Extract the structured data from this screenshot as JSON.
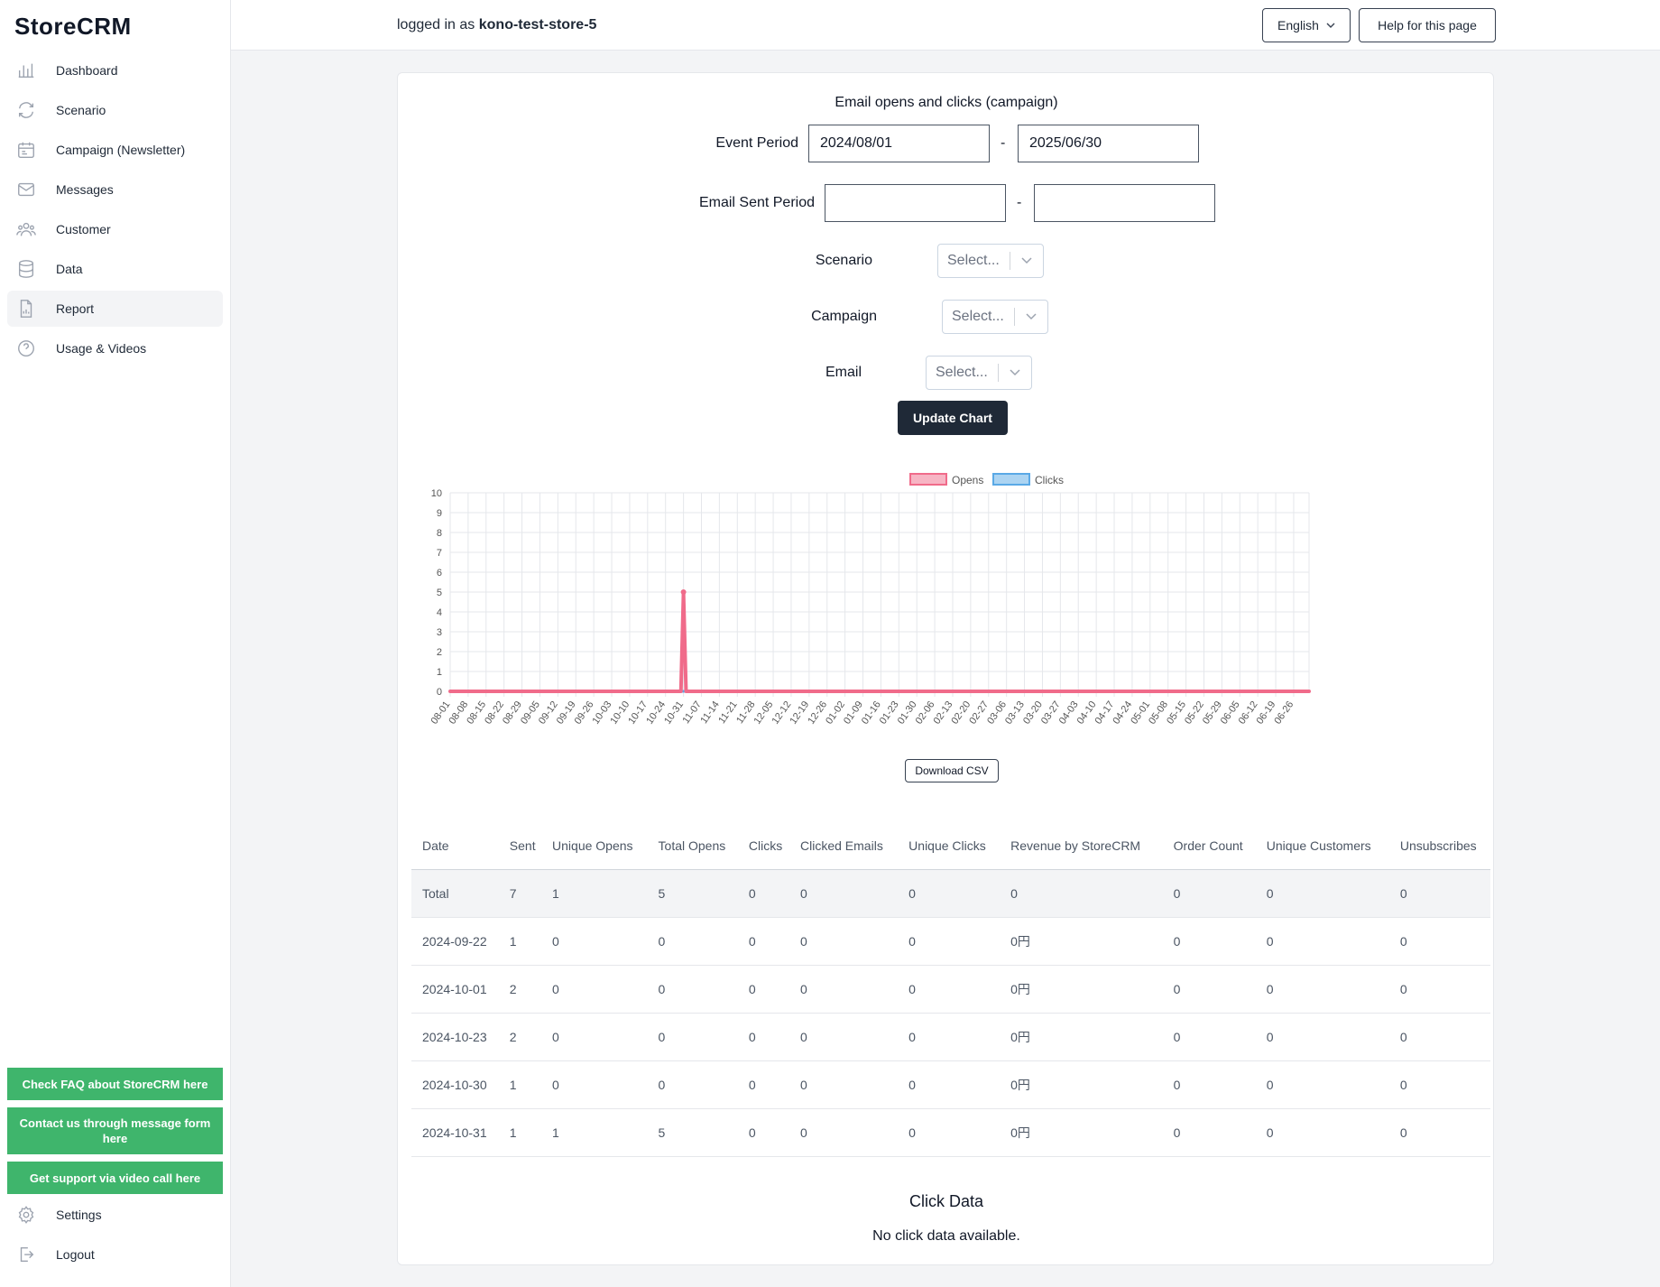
{
  "app": {
    "logo": "StoreCRM"
  },
  "sidebar": {
    "items": [
      {
        "label": "Dashboard",
        "icon": "chart-bars-icon",
        "active": false
      },
      {
        "label": "Scenario",
        "icon": "refresh-icon",
        "active": false
      },
      {
        "label": "Campaign (Newsletter)",
        "icon": "calendar-icon",
        "active": false
      },
      {
        "label": "Messages",
        "icon": "envelope-icon",
        "active": false
      },
      {
        "label": "Customer",
        "icon": "users-icon",
        "active": false
      },
      {
        "label": "Data",
        "icon": "database-icon",
        "active": false
      },
      {
        "label": "Report",
        "icon": "document-chart-icon",
        "active": true
      },
      {
        "label": "Usage & Videos",
        "icon": "question-icon",
        "active": false
      }
    ],
    "help_buttons": [
      "Check FAQ about StoreCRM here",
      "Contact us through message form here",
      "Get support via video call here"
    ],
    "settings_label": "Settings",
    "logout_label": "Logout"
  },
  "header": {
    "logged_in_prefix": "logged in as",
    "store_name": "kono-test-store-5",
    "language_label": "English",
    "help_label": "Help for this page"
  },
  "filters": {
    "title": "Email opens and clicks (campaign)",
    "event_period_label": "Event Period",
    "event_start": "2024/08/01",
    "event_end": "2025/06/30",
    "sent_period_label": "Email Sent Period",
    "sent_start": "",
    "sent_end": "",
    "dash": "-",
    "scenario_label": "Scenario",
    "campaign_label": "Campaign",
    "email_label": "Email",
    "select_placeholder": "Select...",
    "update_label": "Update Chart"
  },
  "chart_data": {
    "type": "line",
    "x": [
      "08-01",
      "08-08",
      "08-15",
      "08-22",
      "08-29",
      "09-05",
      "09-12",
      "09-19",
      "09-26",
      "10-03",
      "10-10",
      "10-17",
      "10-24",
      "10-31",
      "11-07",
      "11-14",
      "11-21",
      "11-28",
      "12-05",
      "12-12",
      "12-19",
      "12-26",
      "01-02",
      "01-09",
      "01-16",
      "01-23",
      "01-30",
      "02-06",
      "02-13",
      "02-20",
      "02-27",
      "03-06",
      "03-13",
      "03-20",
      "03-27",
      "04-03",
      "04-10",
      "04-17",
      "04-24",
      "05-01",
      "05-08",
      "05-15",
      "05-22",
      "05-29",
      "06-05",
      "06-12",
      "06-19",
      "06-26"
    ],
    "series": [
      {
        "name": "Opens",
        "color": "#f06b8a",
        "points": [
          [
            "10-31",
            5
          ]
        ],
        "baseline": 0
      },
      {
        "name": "Clicks",
        "color": "#5aa9e6",
        "points": [],
        "baseline": 0
      }
    ],
    "ylim": [
      0,
      10
    ],
    "yticks": [
      0,
      1,
      2,
      3,
      4,
      5,
      6,
      7,
      8,
      9,
      10
    ],
    "grid": true,
    "legend": "top-center"
  },
  "csv_label": "Download CSV",
  "table": {
    "headers": [
      "Date",
      "Sent",
      "Unique Opens",
      "Total Opens",
      "Clicks",
      "Clicked Emails",
      "Unique Clicks",
      "Revenue by StoreCRM",
      "Order Count",
      "Unique Customers",
      "Unsubscribes"
    ],
    "rows": [
      [
        "Total",
        "7",
        "1",
        "5",
        "0",
        "0",
        "0",
        "0",
        "0",
        "0",
        "0"
      ],
      [
        "2024-09-22",
        "1",
        "0",
        "0",
        "0",
        "0",
        "0",
        "0円",
        "0",
        "0",
        "0"
      ],
      [
        "2024-10-01",
        "2",
        "0",
        "0",
        "0",
        "0",
        "0",
        "0円",
        "0",
        "0",
        "0"
      ],
      [
        "2024-10-23",
        "2",
        "0",
        "0",
        "0",
        "0",
        "0",
        "0円",
        "0",
        "0",
        "0"
      ],
      [
        "2024-10-30",
        "1",
        "0",
        "0",
        "0",
        "0",
        "0",
        "0円",
        "0",
        "0",
        "0"
      ],
      [
        "2024-10-31",
        "1",
        "1",
        "5",
        "0",
        "0",
        "0",
        "0円",
        "0",
        "0",
        "0"
      ]
    ]
  },
  "click_data": {
    "title": "Click Data",
    "empty": "No click data available."
  }
}
